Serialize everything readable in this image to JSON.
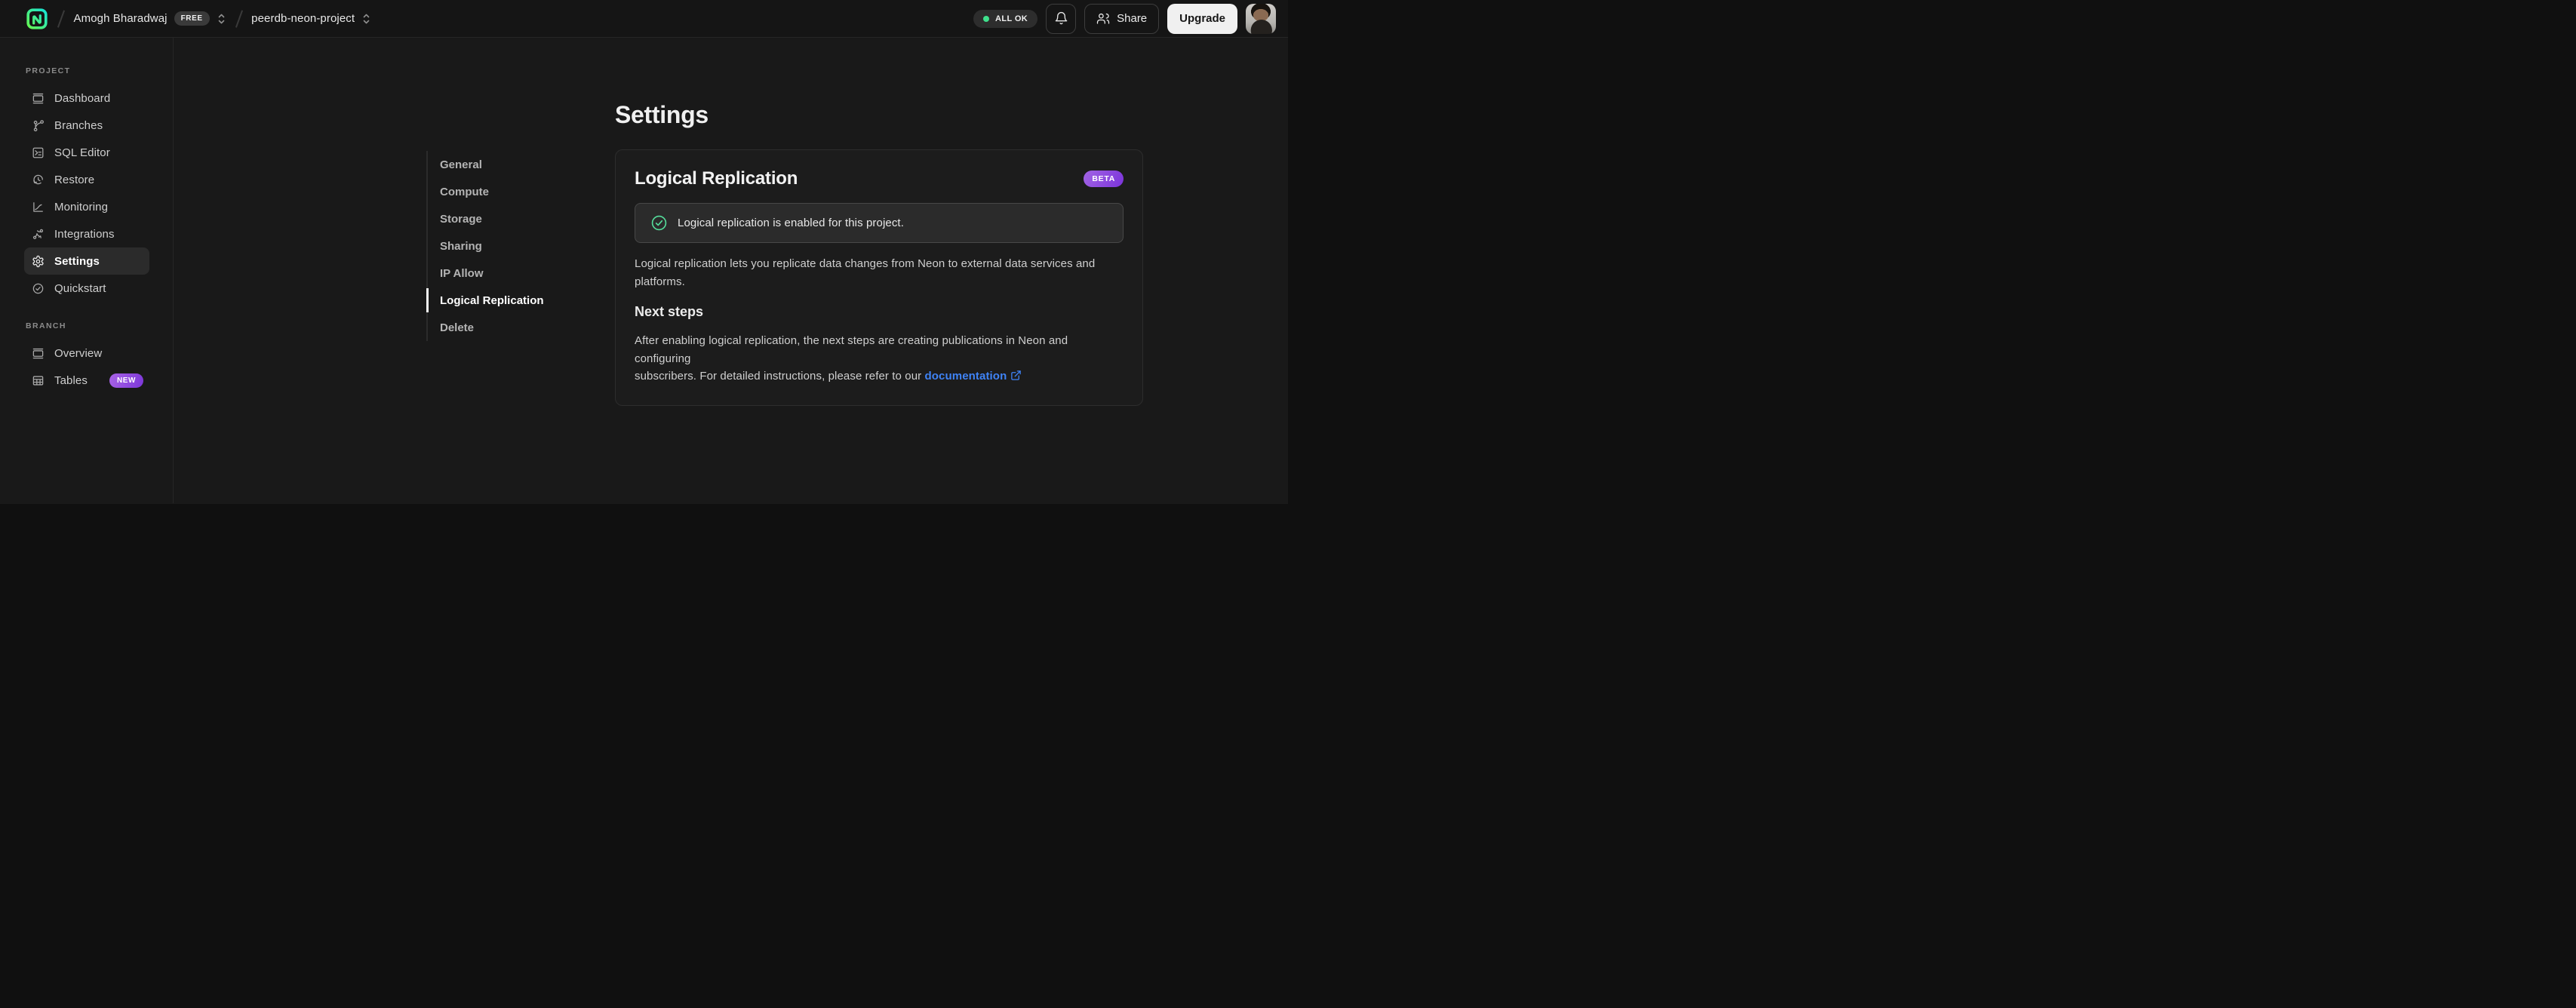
{
  "header": {
    "logo_icon": "neon-logo",
    "breadcrumb": {
      "org_name": "Amogh Bharadwaj",
      "org_plan_badge": "FREE",
      "project_name": "peerdb-neon-project"
    },
    "status_badge": "ALL OK",
    "bell_icon": "bell-icon",
    "share_label": "Share",
    "upgrade_label": "Upgrade"
  },
  "colors": {
    "accent_green": "#3fe08c",
    "badge_purple_start": "#a264e4",
    "badge_purple_end": "#7b33da",
    "link_blue": "#3f83f6"
  },
  "sidebar": {
    "sections": [
      {
        "title": "PROJECT",
        "items": [
          {
            "label": "Dashboard",
            "icon": "window-icon"
          },
          {
            "label": "Branches",
            "icon": "git-branch-icon"
          },
          {
            "label": "SQL Editor",
            "icon": "terminal-icon"
          },
          {
            "label": "Restore",
            "icon": "history-clock-icon"
          },
          {
            "label": "Monitoring",
            "icon": "chart-curve-icon"
          },
          {
            "label": "Integrations",
            "icon": "swap-arrows-icon"
          },
          {
            "label": "Settings",
            "icon": "gear-icon",
            "active": true
          },
          {
            "label": "Quickstart",
            "icon": "check-circle-icon"
          }
        ]
      },
      {
        "title": "BRANCH",
        "items": [
          {
            "label": "Overview",
            "icon": "window-icon"
          },
          {
            "label": "Tables",
            "icon": "table-icon",
            "badge": "NEW"
          }
        ]
      }
    ]
  },
  "settings_nav": {
    "items": [
      {
        "label": "General"
      },
      {
        "label": "Compute"
      },
      {
        "label": "Storage"
      },
      {
        "label": "Sharing"
      },
      {
        "label": "IP Allow"
      },
      {
        "label": "Logical Replication",
        "active": true
      },
      {
        "label": "Delete"
      }
    ]
  },
  "main": {
    "page_title": "Settings",
    "card": {
      "title": "Logical Replication",
      "badge": "BETA",
      "alert_icon": "check-circle-icon",
      "alert_text": "Logical replication is enabled for this project.",
      "description_line1": "Logical replication lets you replicate data changes from Neon to external data services and",
      "description_line2": "platforms.",
      "next_steps_title": "Next steps",
      "next_steps_line1": "After enabling logical replication, the next steps are creating publications in Neon and configuring",
      "next_steps_line2": "subscribers. For detailed instructions, please refer to our",
      "link_label": "documentation",
      "link_icon": "external-link-icon"
    }
  }
}
